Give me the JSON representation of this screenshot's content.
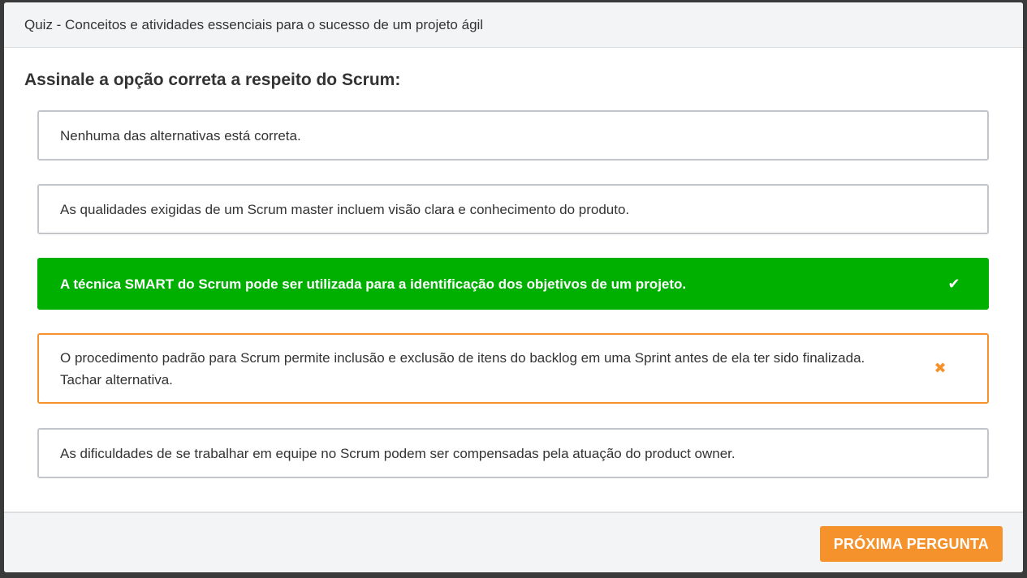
{
  "header": {
    "title": "Quiz - Conceitos e atividades essenciais para o sucesso de um projeto ágil"
  },
  "question": {
    "text": "Assinale a opção correta a respeito do Scrum:"
  },
  "options": [
    {
      "text": "Nenhuma das alternativas está correta.",
      "state": "neutral",
      "mark": ""
    },
    {
      "text": "As qualidades exigidas de um Scrum master incluem visão clara e conhecimento do produto.",
      "state": "neutral",
      "mark": ""
    },
    {
      "text": "A técnica SMART do Scrum pode ser utilizada para a identificação dos objetivos de um projeto.",
      "state": "correct",
      "mark": "✔"
    },
    {
      "text": "O procedimento padrão para Scrum permite inclusão e exclusão de itens do backlog em uma Sprint antes de ela ter sido finalizada. Tachar alternativa.",
      "state": "wrong",
      "mark": "✖"
    },
    {
      "text": "As dificuldades de se trabalhar em equipe no Scrum podem ser compensadas pela atuação do product owner.",
      "state": "neutral",
      "mark": ""
    }
  ],
  "footer": {
    "next_label": "PRÓXIMA PERGUNTA"
  },
  "colors": {
    "correct": "#00b000",
    "wrong": "#f5922b",
    "button": "#f5922b"
  }
}
